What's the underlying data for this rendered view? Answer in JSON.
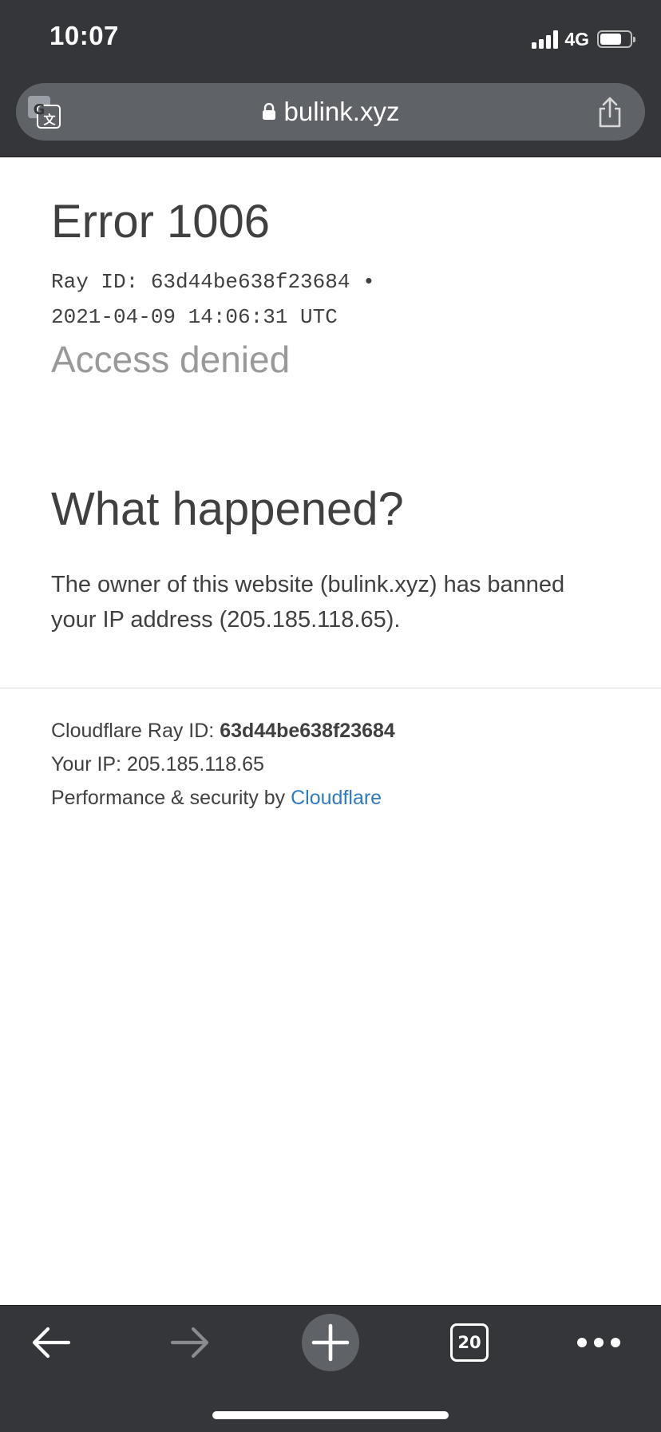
{
  "status_bar": {
    "time": "10:07",
    "network": "4G",
    "icons": [
      "signal-icon",
      "battery-icon"
    ]
  },
  "browser": {
    "url": "bulink.xyz",
    "icons": [
      "translate-icon",
      "lock-icon",
      "share-icon"
    ]
  },
  "page": {
    "error_title": "Error 1006",
    "ray_line_1": "Ray ID: 63d44be638f23684 •",
    "ray_line_2": "2021-04-09 14:06:31 UTC",
    "access_denied": "Access denied",
    "what_happened_heading": "What happened?",
    "explanation": "The owner of this website (bulink.xyz) has banned your IP address (205.185.118.65).",
    "footer": {
      "ray_label": "Cloudflare Ray ID: ",
      "ray_value": "63d44be638f23684",
      "ip_text": "Your IP: 205.185.118.65",
      "perf_text": "Performance & security by ",
      "cloudflare_link": "Cloudflare"
    }
  },
  "toolbar": {
    "tab_count": "20",
    "icons": [
      "back-arrow-icon",
      "forward-arrow-icon",
      "plus-icon",
      "tabs-icon",
      "more-icon"
    ]
  },
  "colors": {
    "chrome_bg": "#35363a",
    "url_bar_bg": "#5f6266",
    "text": "#404040",
    "muted_text": "#999999",
    "link": "#2f7bbf"
  }
}
